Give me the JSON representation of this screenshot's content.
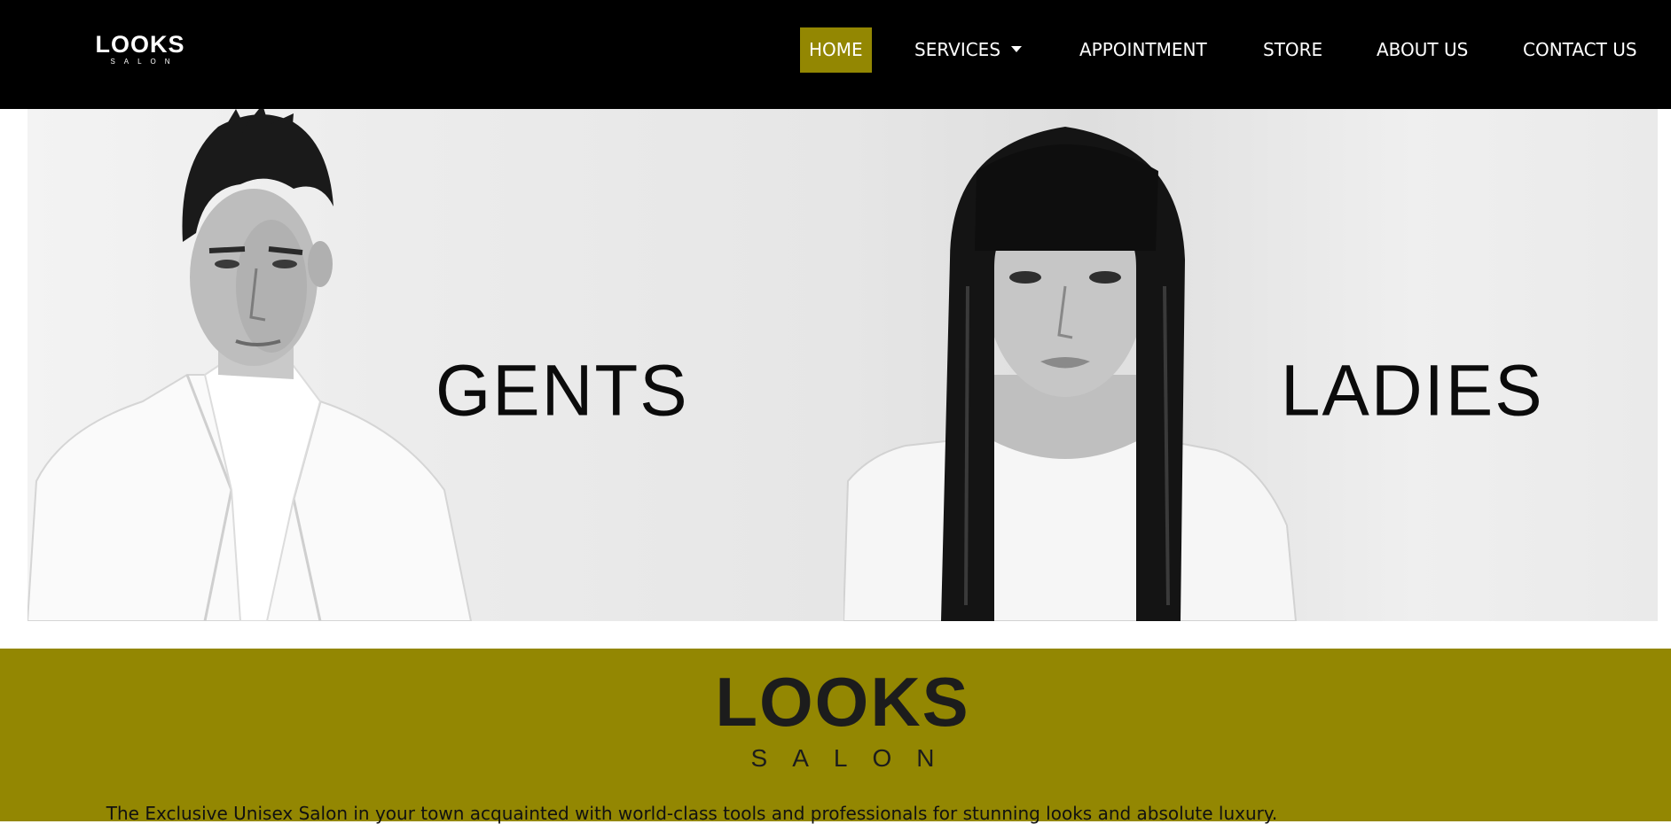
{
  "header": {
    "logo": {
      "main": "LOOKS",
      "sub": "SALON"
    },
    "nav": {
      "home": "HOME",
      "services": "SERVICES",
      "appointment": "APPOINTMENT",
      "store": "STORE",
      "about": "ABOUT US",
      "contact": "CONTACT US"
    },
    "active_item": "HOME",
    "services_dropdown_icon": "caret-down-icon"
  },
  "hero": {
    "gents": {
      "label": "GENTS"
    },
    "ladies": {
      "label": "LADIES"
    }
  },
  "brand": {
    "logo_main": "LOOKS",
    "logo_sub": "SALON",
    "tagline": "The Exclusive Unisex Salon in your town acquainted with world-class tools and professionals for stunning looks and absolute luxury."
  },
  "colors": {
    "nav_background": "#000000",
    "accent": "#938702",
    "nav_text": "#ffffff",
    "brand_text": "#1c1c1c"
  }
}
